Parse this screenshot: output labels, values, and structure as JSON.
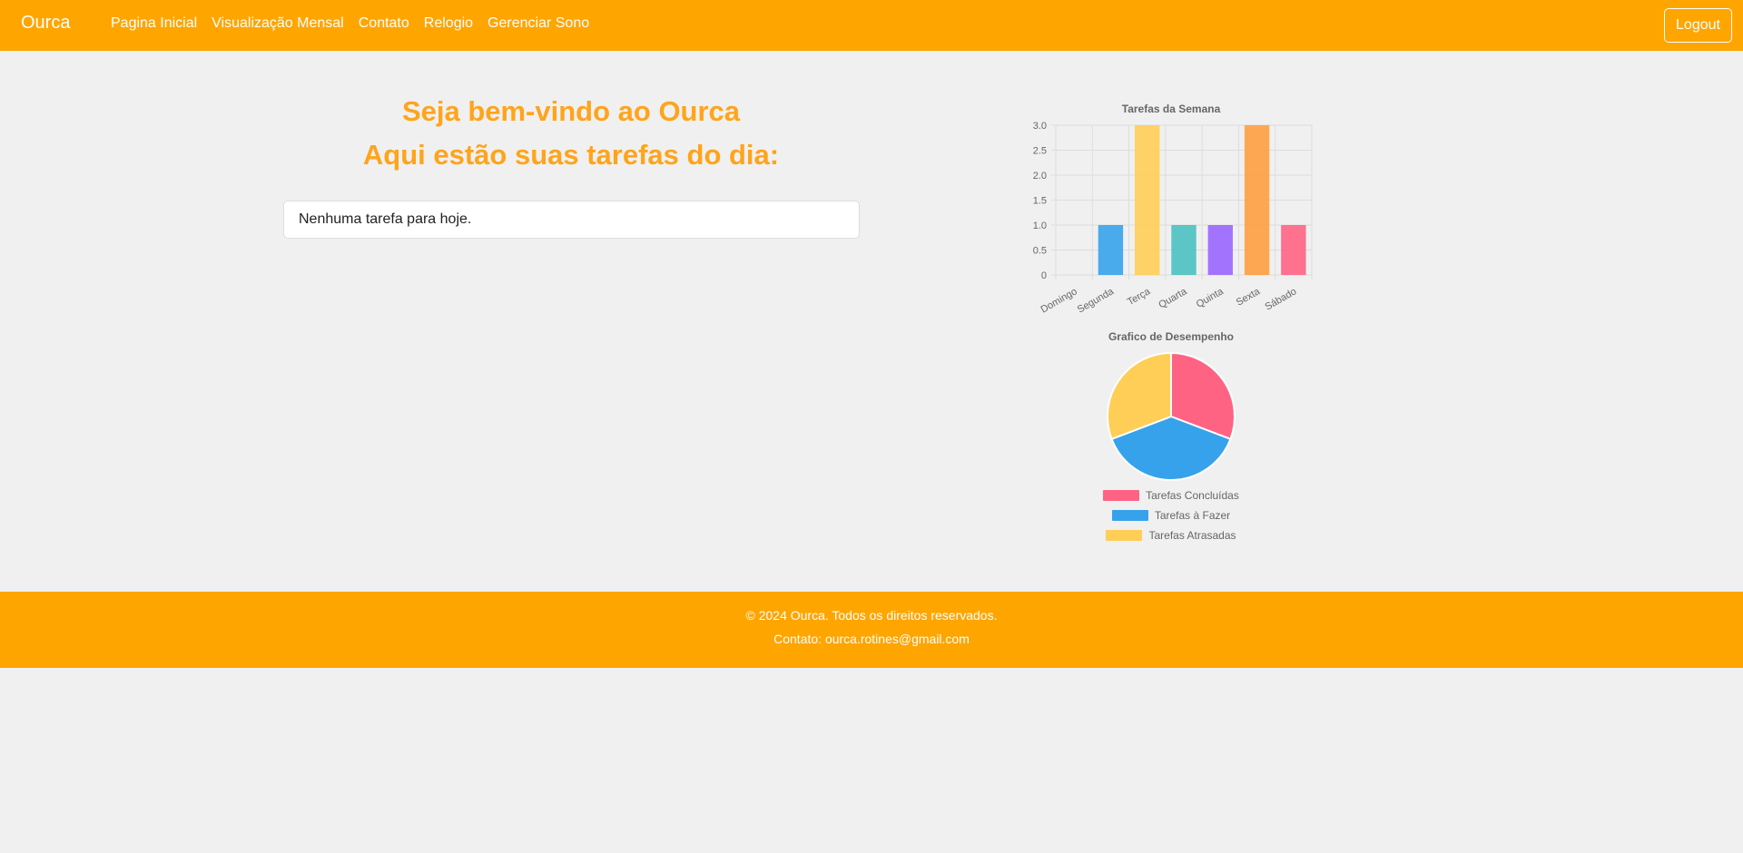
{
  "nav": {
    "brand": "Ourca",
    "links": [
      "Pagina Inicial",
      "Visualização Mensal",
      "Contato",
      "Relogio",
      "Gerenciar Sono"
    ],
    "logout": "Logout"
  },
  "main": {
    "welcome": "Seja bem-vindo ao Ourca",
    "tasks_heading": "Aqui estão suas tarefas do dia:",
    "empty_message": "Nenhuma tarefa para hoje."
  },
  "colors": {
    "accent": "#ffa500",
    "heading": "#ffa41b"
  },
  "chart_data": [
    {
      "type": "bar",
      "title": "Tarefas da Semana",
      "categories": [
        "Domingo",
        "Segunda",
        "Terça",
        "Quarta",
        "Quinta",
        "Sexta",
        "Sábado"
      ],
      "values": [
        0,
        1,
        3,
        1,
        1,
        3,
        1
      ],
      "colors": [
        "#ff6384",
        "#36a2eb",
        "#ffce56",
        "#4bc0c0",
        "#9966ff",
        "#ff9f40",
        "#ff6384"
      ],
      "ylim": [
        0,
        3
      ],
      "yticks": [
        "3.0",
        "2.5",
        "2.0",
        "1.5",
        "1.0",
        "0.5",
        "0"
      ],
      "grid": true
    },
    {
      "type": "pie",
      "title": "Grafico de Desempenho",
      "labels": [
        "Tarefas Concluídas",
        "Tarefas à Fazer",
        "Tarefas Atrasadas"
      ],
      "values": [
        1,
        1.25,
        1
      ],
      "colors": [
        "#ff6384",
        "#36a2eb",
        "#ffce56"
      ],
      "legend": "bottom"
    }
  ],
  "footer": {
    "copyright": "© 2024 Ourca. Todos os direitos reservados.",
    "contact": "Contato: ourca.rotines@gmail.com"
  }
}
